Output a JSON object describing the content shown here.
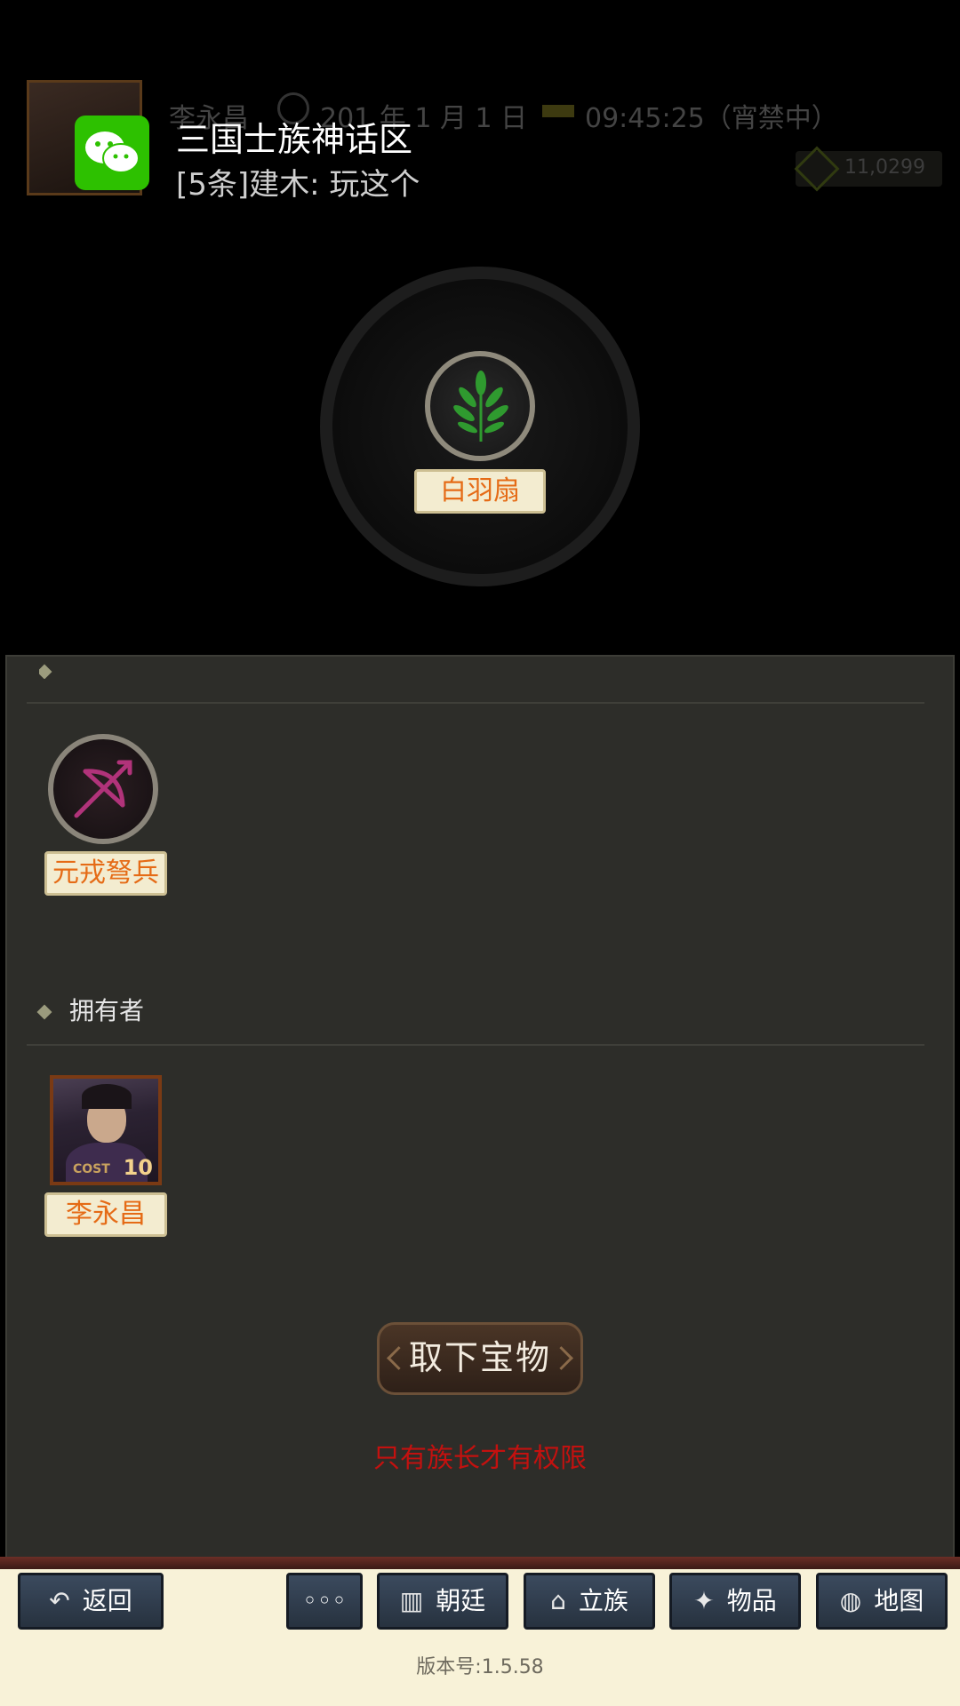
{
  "status_bar": {
    "player_name": "李永昌",
    "date": "201 年 1 月 1 日",
    "time": "09:45:25（宵禁中）",
    "currency": "11,0299"
  },
  "notification": {
    "app": "wechat-icon",
    "title": "三国士族神话区",
    "message": "[5条]建木: 玩这个"
  },
  "treasure": {
    "name": "白羽扇",
    "icon": "leaf-icon"
  },
  "trait_section": {
    "icon": "crossbow-icon",
    "unit_name": "元戎弩兵"
  },
  "owner_section": {
    "heading": "拥有者",
    "owner_name": "李永昌",
    "cost_label": "COST",
    "cost_value": "10"
  },
  "actions": {
    "take_off_label": "取下宝物",
    "permission_note": "只有族长才有权限"
  },
  "nav": {
    "back": "返回",
    "more": "◦◦◦",
    "court": "朝廷",
    "clan": "立族",
    "items": "物品",
    "map": "地图"
  },
  "version": "版本号:1.5.58",
  "colors": {
    "accent_orange": "#e56b16",
    "warning_red": "#c3110f",
    "wechat_green": "#2dc100"
  }
}
